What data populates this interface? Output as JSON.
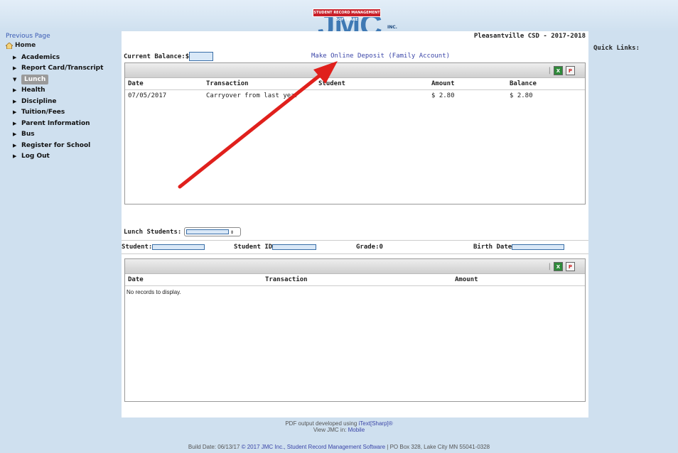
{
  "header": {
    "logo_banner": "STUDENT RECORD MANAGEMENT SOFTWARE",
    "logo_letters": "JMC",
    "logo_inc": "INC."
  },
  "sidebar": {
    "prev_page": "Previous Page",
    "home": "Home",
    "items": [
      {
        "label": "Academics",
        "active": false
      },
      {
        "label": "Report Card/Transcript",
        "active": false
      },
      {
        "label": "Lunch",
        "active": true
      },
      {
        "label": "Health",
        "active": false
      },
      {
        "label": "Discipline",
        "active": false
      },
      {
        "label": "Tuition/Fees",
        "active": false
      },
      {
        "label": "Parent Information",
        "active": false
      },
      {
        "label": "Bus",
        "active": false
      },
      {
        "label": "Register for School",
        "active": false
      },
      {
        "label": "Log Out",
        "active": false
      }
    ]
  },
  "district": "Pleasantville CSD - 2017-2018",
  "quick_links": "Quick Links:",
  "balance": {
    "label": "Current Balance:$",
    "deposit_link": "Make Online Deposit (Family Account)"
  },
  "transactions_grid": {
    "columns": [
      "Date",
      "Transaction",
      "Student",
      "Amount",
      "Balance"
    ],
    "rows": [
      {
        "date": "07/05/2017",
        "transaction": "Carryover from last year",
        "student": "",
        "amount": "$ 2.80",
        "balance": "$ 2.80"
      }
    ]
  },
  "lunch_students": {
    "label": "Lunch Students:",
    "student_label": "Student:",
    "student_id_label": "Student ID",
    "grade_label": "Grade:0",
    "birth_date_label": "Birth Date"
  },
  "records_grid": {
    "columns": [
      "Date",
      "Transaction",
      "Amount"
    ],
    "empty_text": "No records to display."
  },
  "toolbar": {
    "separator": "|",
    "excel_icon": "excel-export-icon",
    "pdf_icon": "pdf-export-icon"
  },
  "footer": {
    "pdf_text": "PDF output developed using ",
    "pdf_link": "iText[Sharp]®",
    "view_text": "View JMC in: ",
    "view_link": "Mobile",
    "build_prefix": "Build Date: 06/13/17 ",
    "build_link": "© 2017 JMC Inc., Student Record Management Software",
    "build_suffix": " | PO Box 328, Lake City MN 55041-0328"
  },
  "annotation": {
    "arrow_color": "#e0201c"
  }
}
